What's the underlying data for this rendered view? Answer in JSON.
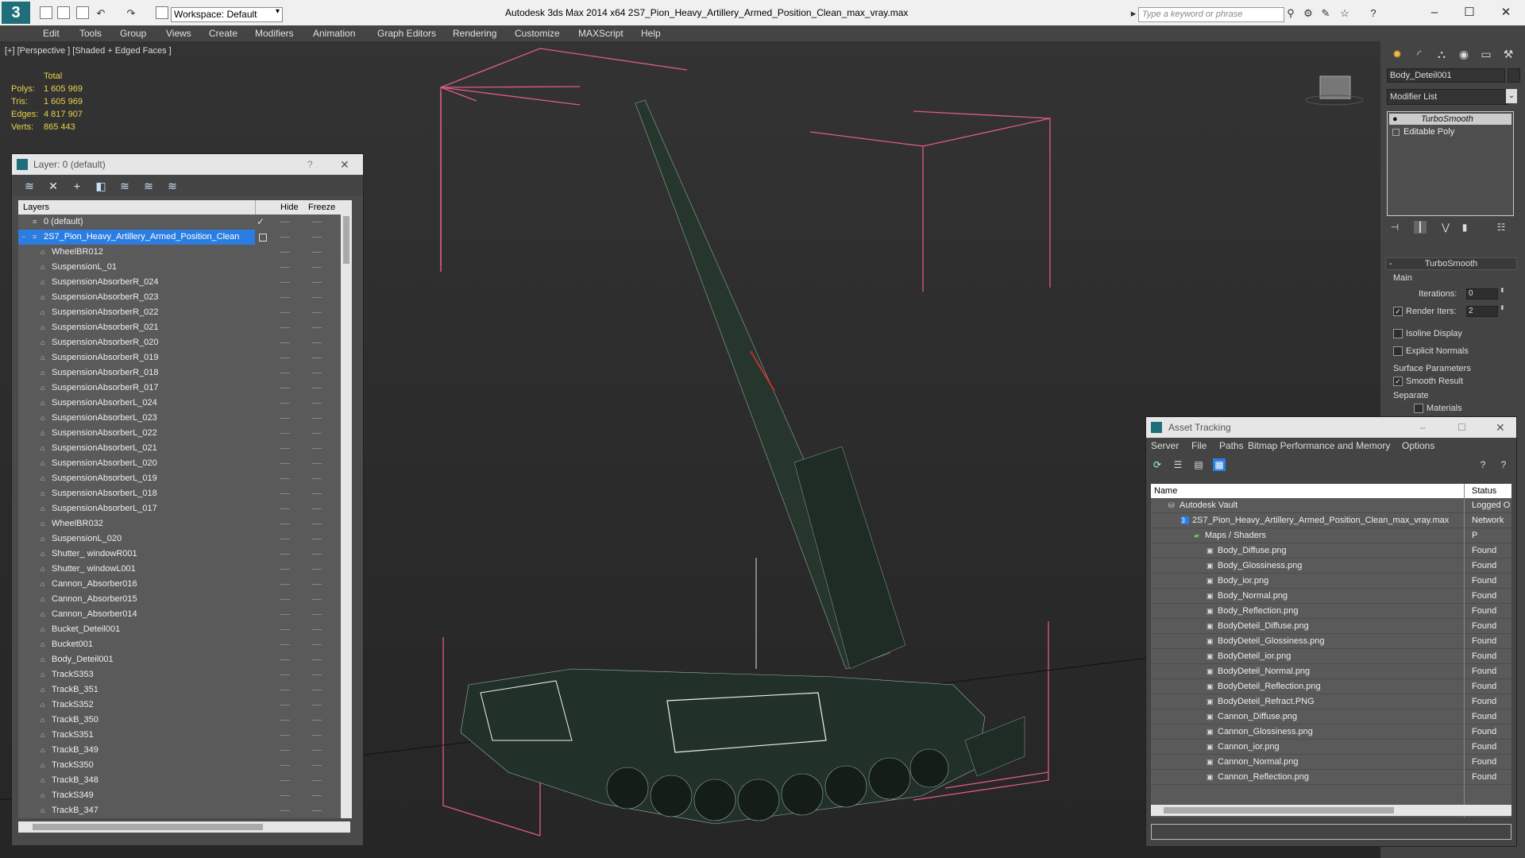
{
  "titlebar": {
    "workspace": "Workspace: Default",
    "app_title": "Autodesk 3ds Max  2014 x64      2S7_Pion_Heavy_Artillery_Armed_Position_Clean_max_vray.max",
    "search_placeholder": "Type a keyword or phrase"
  },
  "menu": [
    "Edit",
    "Tools",
    "Group",
    "Views",
    "Create",
    "Modifiers",
    "Animation",
    "Graph Editors",
    "Rendering",
    "Customize",
    "MAXScript",
    "Help"
  ],
  "viewport": {
    "label": "[+] [Perspective ] [Shaded + Edged Faces ]",
    "stats": {
      "total_label": "Total",
      "polys_label": "Polys:",
      "polys": "1 605 969",
      "tris_label": "Tris:",
      "tris": "1 605 969",
      "edges_label": "Edges:",
      "edges": "4 817 907",
      "verts_label": "Verts:",
      "verts": "865 443"
    }
  },
  "layer_panel": {
    "title": "Layer: 0 (default)",
    "help": "?",
    "col_layers": "Layers",
    "col_hide": "Hide",
    "col_freeze": "Freeze",
    "rows": [
      "0 (default)",
      "2S7_Pion_Heavy_Artillery_Armed_Position_Clean",
      "WheelBR012",
      "SuspensionL_01",
      "SuspensionAbsorberR_024",
      "SuspensionAbsorberR_023",
      "SuspensionAbsorberR_022",
      "SuspensionAbsorberR_021",
      "SuspensionAbsorberR_020",
      "SuspensionAbsorberR_019",
      "SuspensionAbsorberR_018",
      "SuspensionAbsorberR_017",
      "SuspensionAbsorberL_024",
      "SuspensionAbsorberL_023",
      "SuspensionAbsorberL_022",
      "SuspensionAbsorberL_021",
      "SuspensionAbsorberL_020",
      "SuspensionAbsorberL_019",
      "SuspensionAbsorberL_018",
      "SuspensionAbsorberL_017",
      "WheelBR032",
      "SuspensionL_020",
      "Shutter_ windowR001",
      "Shutter_ windowL001",
      "Cannon_Absorber016",
      "Cannon_Absorber015",
      "Cannon_Absorber014",
      "Bucket_Deteil001",
      "Bucket001",
      "Body_Deteil001",
      "TrackS353",
      "TrackB_351",
      "TrackS352",
      "TrackB_350",
      "TrackS351",
      "TrackB_349",
      "TrackS350",
      "TrackB_348",
      "TrackS349",
      "TrackB_347"
    ]
  },
  "command_panel": {
    "object_name": "Body_Deteil001",
    "modifier_list": "Modifier List",
    "stack": [
      "TurboSmooth",
      "Editable Poly"
    ],
    "rollout": "TurboSmooth",
    "main": "Main",
    "iterations_label": "Iterations:",
    "iterations": "0",
    "render_iters_label": "Render Iters:",
    "render_iters": "2",
    "isoline": "Isoline Display",
    "explicit_normals": "Explicit Normals",
    "surface_params": "Surface Parameters",
    "smooth_result": "Smooth Result",
    "separate": "Separate",
    "materials": "Materials"
  },
  "asset_tracking": {
    "title": "Asset Tracking",
    "menu": [
      "Server",
      "File",
      "Paths",
      "Bitmap Performance and Memory",
      "Options"
    ],
    "col_name": "Name",
    "col_status": "Status",
    "rows": [
      {
        "name": "Autodesk Vault",
        "status": "Logged O",
        "indent": 1
      },
      {
        "name": "2S7_Pion_Heavy_Artillery_Armed_Position_Clean_max_vray.max",
        "status": "Network P",
        "indent": 2
      },
      {
        "name": "Maps / Shaders",
        "status": "",
        "indent": 3
      },
      {
        "name": "Body_Diffuse.png",
        "status": "Found",
        "indent": 4
      },
      {
        "name": "Body_Glossiness.png",
        "status": "Found",
        "indent": 4
      },
      {
        "name": "Body_ior.png",
        "status": "Found",
        "indent": 4
      },
      {
        "name": "Body_Normal.png",
        "status": "Found",
        "indent": 4
      },
      {
        "name": "Body_Reflection.png",
        "status": "Found",
        "indent": 4
      },
      {
        "name": "BodyDeteil_Diffuse.png",
        "status": "Found",
        "indent": 4
      },
      {
        "name": "BodyDeteil_Glossiness.png",
        "status": "Found",
        "indent": 4
      },
      {
        "name": "BodyDeteil_ior.png",
        "status": "Found",
        "indent": 4
      },
      {
        "name": "BodyDeteil_Normal.png",
        "status": "Found",
        "indent": 4
      },
      {
        "name": "BodyDeteil_Reflection.png",
        "status": "Found",
        "indent": 4
      },
      {
        "name": "BodyDeteil_Refract.PNG",
        "status": "Found",
        "indent": 4
      },
      {
        "name": "Cannon_Diffuse.png",
        "status": "Found",
        "indent": 4
      },
      {
        "name": "Cannon_Glossiness.png",
        "status": "Found",
        "indent": 4
      },
      {
        "name": "Cannon_ior.png",
        "status": "Found",
        "indent": 4
      },
      {
        "name": "Cannon_Normal.png",
        "status": "Found",
        "indent": 4
      },
      {
        "name": "Cannon_Reflection.png",
        "status": "Found",
        "indent": 4
      }
    ]
  },
  "colors": {
    "selection": "#2b7de1",
    "stats": "#e8d24a",
    "bbox": "#e05a8c"
  }
}
